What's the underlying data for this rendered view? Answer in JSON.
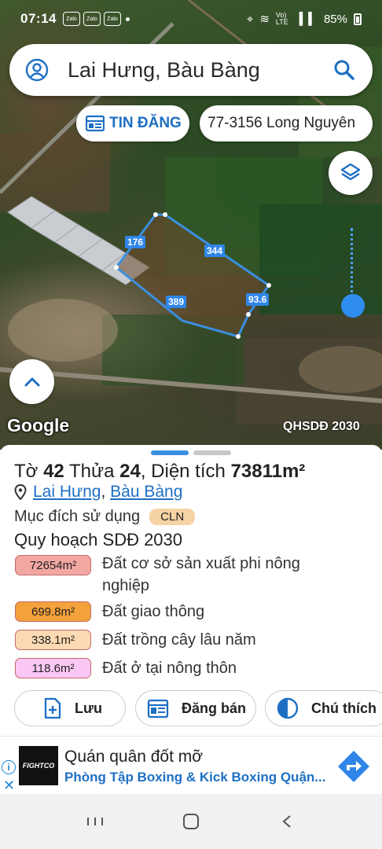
{
  "status_bar": {
    "time": "07:14",
    "apps": [
      "Zalo",
      "Zalo",
      "Zalo"
    ],
    "network": "Vo) LTE",
    "battery": "85%"
  },
  "search": {
    "title": "Lai Hưng, Bàu Bàng"
  },
  "chips": {
    "listing": "TIN ĐĂNG",
    "phone": "77-3156 Long Nguyên"
  },
  "map": {
    "edge_labels": [
      "176",
      "344",
      "389",
      "93.6"
    ],
    "google_logo": "Google",
    "layer_label": "QHSDĐ 2030",
    "parcel_outline_color": "#3a8fe0",
    "slider_value": 1.0
  },
  "parcel": {
    "title_prefix": "Tờ",
    "sheet_no": "42",
    "plot_prefix": "Thửa",
    "plot_no": "24",
    "area_prefix": ", Diện tích",
    "area": "73811m²",
    "location_commune": "Lai Hưng",
    "location_sep": ",",
    "location_district": "Bàu Bàng",
    "purpose_label": "Mục đích sử dụng",
    "purpose_code": "CLN",
    "plan_title": "Quy hoạch SDĐ 2030"
  },
  "land_use": [
    {
      "area": "72654m²",
      "label": "Đất cơ sở sản xuất phi nông nghiệp",
      "color": "#f3a7a3"
    },
    {
      "area": "699.8m²",
      "label": "Đất giao thông",
      "color": "#f2a13b"
    },
    {
      "area": "338.1m²",
      "label": "Đất trồng cây lâu năm",
      "color": "#fbd9b2"
    },
    {
      "area": "118.6m²",
      "label": "Đất ở tại nông thôn",
      "color": "#fbc8f5"
    }
  ],
  "actions": {
    "save": "Lưu",
    "sell": "Đăng bán",
    "legend": "Chú thích"
  },
  "ad": {
    "logo_text": "FIGHTCO",
    "headline": "Quán quân đốt mỡ",
    "subline": "Phòng Tập Boxing & Kick Boxing Quận..."
  },
  "colors": {
    "accent": "#1e6fc4",
    "slider": "#2f8df0"
  }
}
